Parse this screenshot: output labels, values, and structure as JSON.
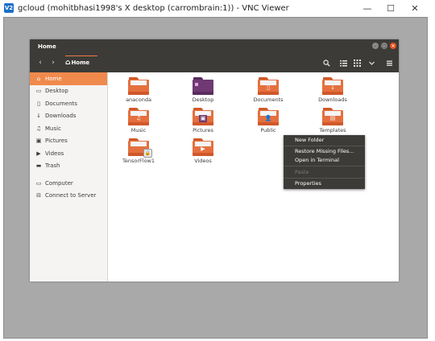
{
  "vnc": {
    "logo": "V2",
    "title": "gcloud (mohitbhasi1998's X desktop (carrombrain:1)) - VNC Viewer",
    "minimize_icon": "—",
    "maximize_icon": "☐",
    "close_icon": "✕"
  },
  "window": {
    "title": "Home",
    "path": "Home"
  },
  "sidebar": {
    "items": [
      {
        "label": "Home",
        "icon": "home-icon",
        "glyph": "⌂"
      },
      {
        "label": "Desktop",
        "icon": "desktop-icon",
        "glyph": "▭"
      },
      {
        "label": "Documents",
        "icon": "documents-icon",
        "glyph": "▯"
      },
      {
        "label": "Downloads",
        "icon": "downloads-icon",
        "glyph": "↓"
      },
      {
        "label": "Music",
        "icon": "music-icon",
        "glyph": "♫"
      },
      {
        "label": "Pictures",
        "icon": "pictures-icon",
        "glyph": "▣"
      },
      {
        "label": "Videos",
        "icon": "videos-icon",
        "glyph": "▶"
      },
      {
        "label": "Trash",
        "icon": "trash-icon",
        "glyph": "▬"
      },
      {
        "label": "Computer",
        "icon": "computer-icon",
        "glyph": "▭"
      },
      {
        "label": "Connect to Server",
        "icon": "server-icon",
        "glyph": "⊟"
      }
    ]
  },
  "files": [
    {
      "name": "anaconda"
    },
    {
      "name": "Desktop"
    },
    {
      "name": "Documents"
    },
    {
      "name": "Downloads"
    },
    {
      "name": "Music"
    },
    {
      "name": "Pictures"
    },
    {
      "name": "Public"
    },
    {
      "name": "Templates"
    },
    {
      "name": "TensorFlow1"
    },
    {
      "name": "Videos"
    }
  ],
  "context_menu": {
    "items": [
      {
        "label": "New Folder",
        "enabled": true
      },
      {
        "label": "Restore Missing Files...",
        "enabled": true
      },
      {
        "label": "Open in Terminal",
        "enabled": true
      },
      {
        "label": "Paste",
        "enabled": false
      },
      {
        "label": "Properties",
        "enabled": true
      }
    ]
  },
  "colors": {
    "accent": "#f08a4c",
    "header": "#3c3b37",
    "folder": "#e5703f",
    "close": "#e95420"
  }
}
